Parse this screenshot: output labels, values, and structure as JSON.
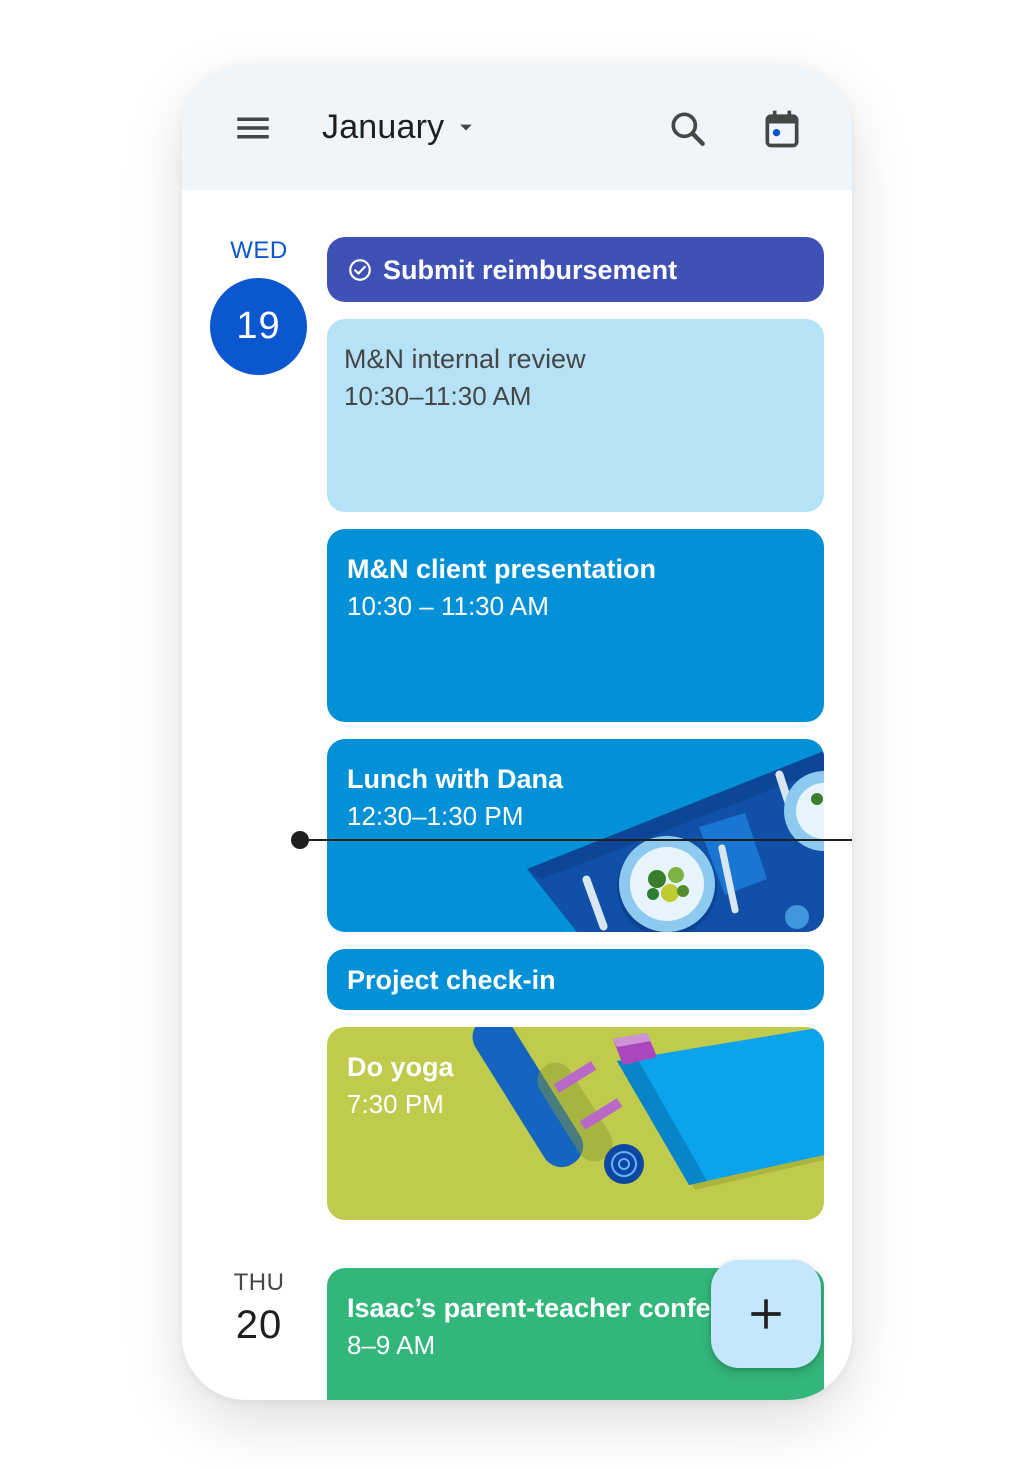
{
  "header": {
    "month": "January",
    "icons": {
      "menu": "menu-icon",
      "dropdown": "arrow-drop-down-icon",
      "search": "search-icon",
      "today": "today-calendar-icon"
    }
  },
  "days": [
    {
      "weekday": "WED",
      "date": "19",
      "is_today": true
    },
    {
      "weekday": "THU",
      "date": "20",
      "is_today": false
    }
  ],
  "events": [
    {
      "title": "Submit reimbursement",
      "time": "",
      "kind": "task",
      "icon": "check-circle-icon",
      "color": "#3f51b5"
    },
    {
      "title": "M&N internal review",
      "time": "10:30–11:30 AM",
      "color": "#b5e2f7"
    },
    {
      "title": "M&N client presentation",
      "time": "10:30 – 11:30 AM",
      "color": "#0291d6"
    },
    {
      "title": "Lunch with Dana",
      "time": "12:30–1:30 PM",
      "color": "#0291d6",
      "illustration": "lunch-table-illustration"
    },
    {
      "title": "Project check-in",
      "time": "",
      "color": "#0291d6"
    },
    {
      "title": "Do yoga",
      "time": "7:30 PM",
      "color": "#c0ca4c",
      "illustration": "yoga-mat-illustration"
    },
    {
      "title": "Isaac’s parent-teacher confe",
      "time": "8–9 AM",
      "color": "#33b679"
    }
  ],
  "fab": {
    "icon": "add-icon"
  },
  "colors": {
    "accent": "#0b57d0",
    "header_bg": "#f0f5fa",
    "fab_bg": "#c2e7ff",
    "now_indicator": "#1f1f1f"
  }
}
